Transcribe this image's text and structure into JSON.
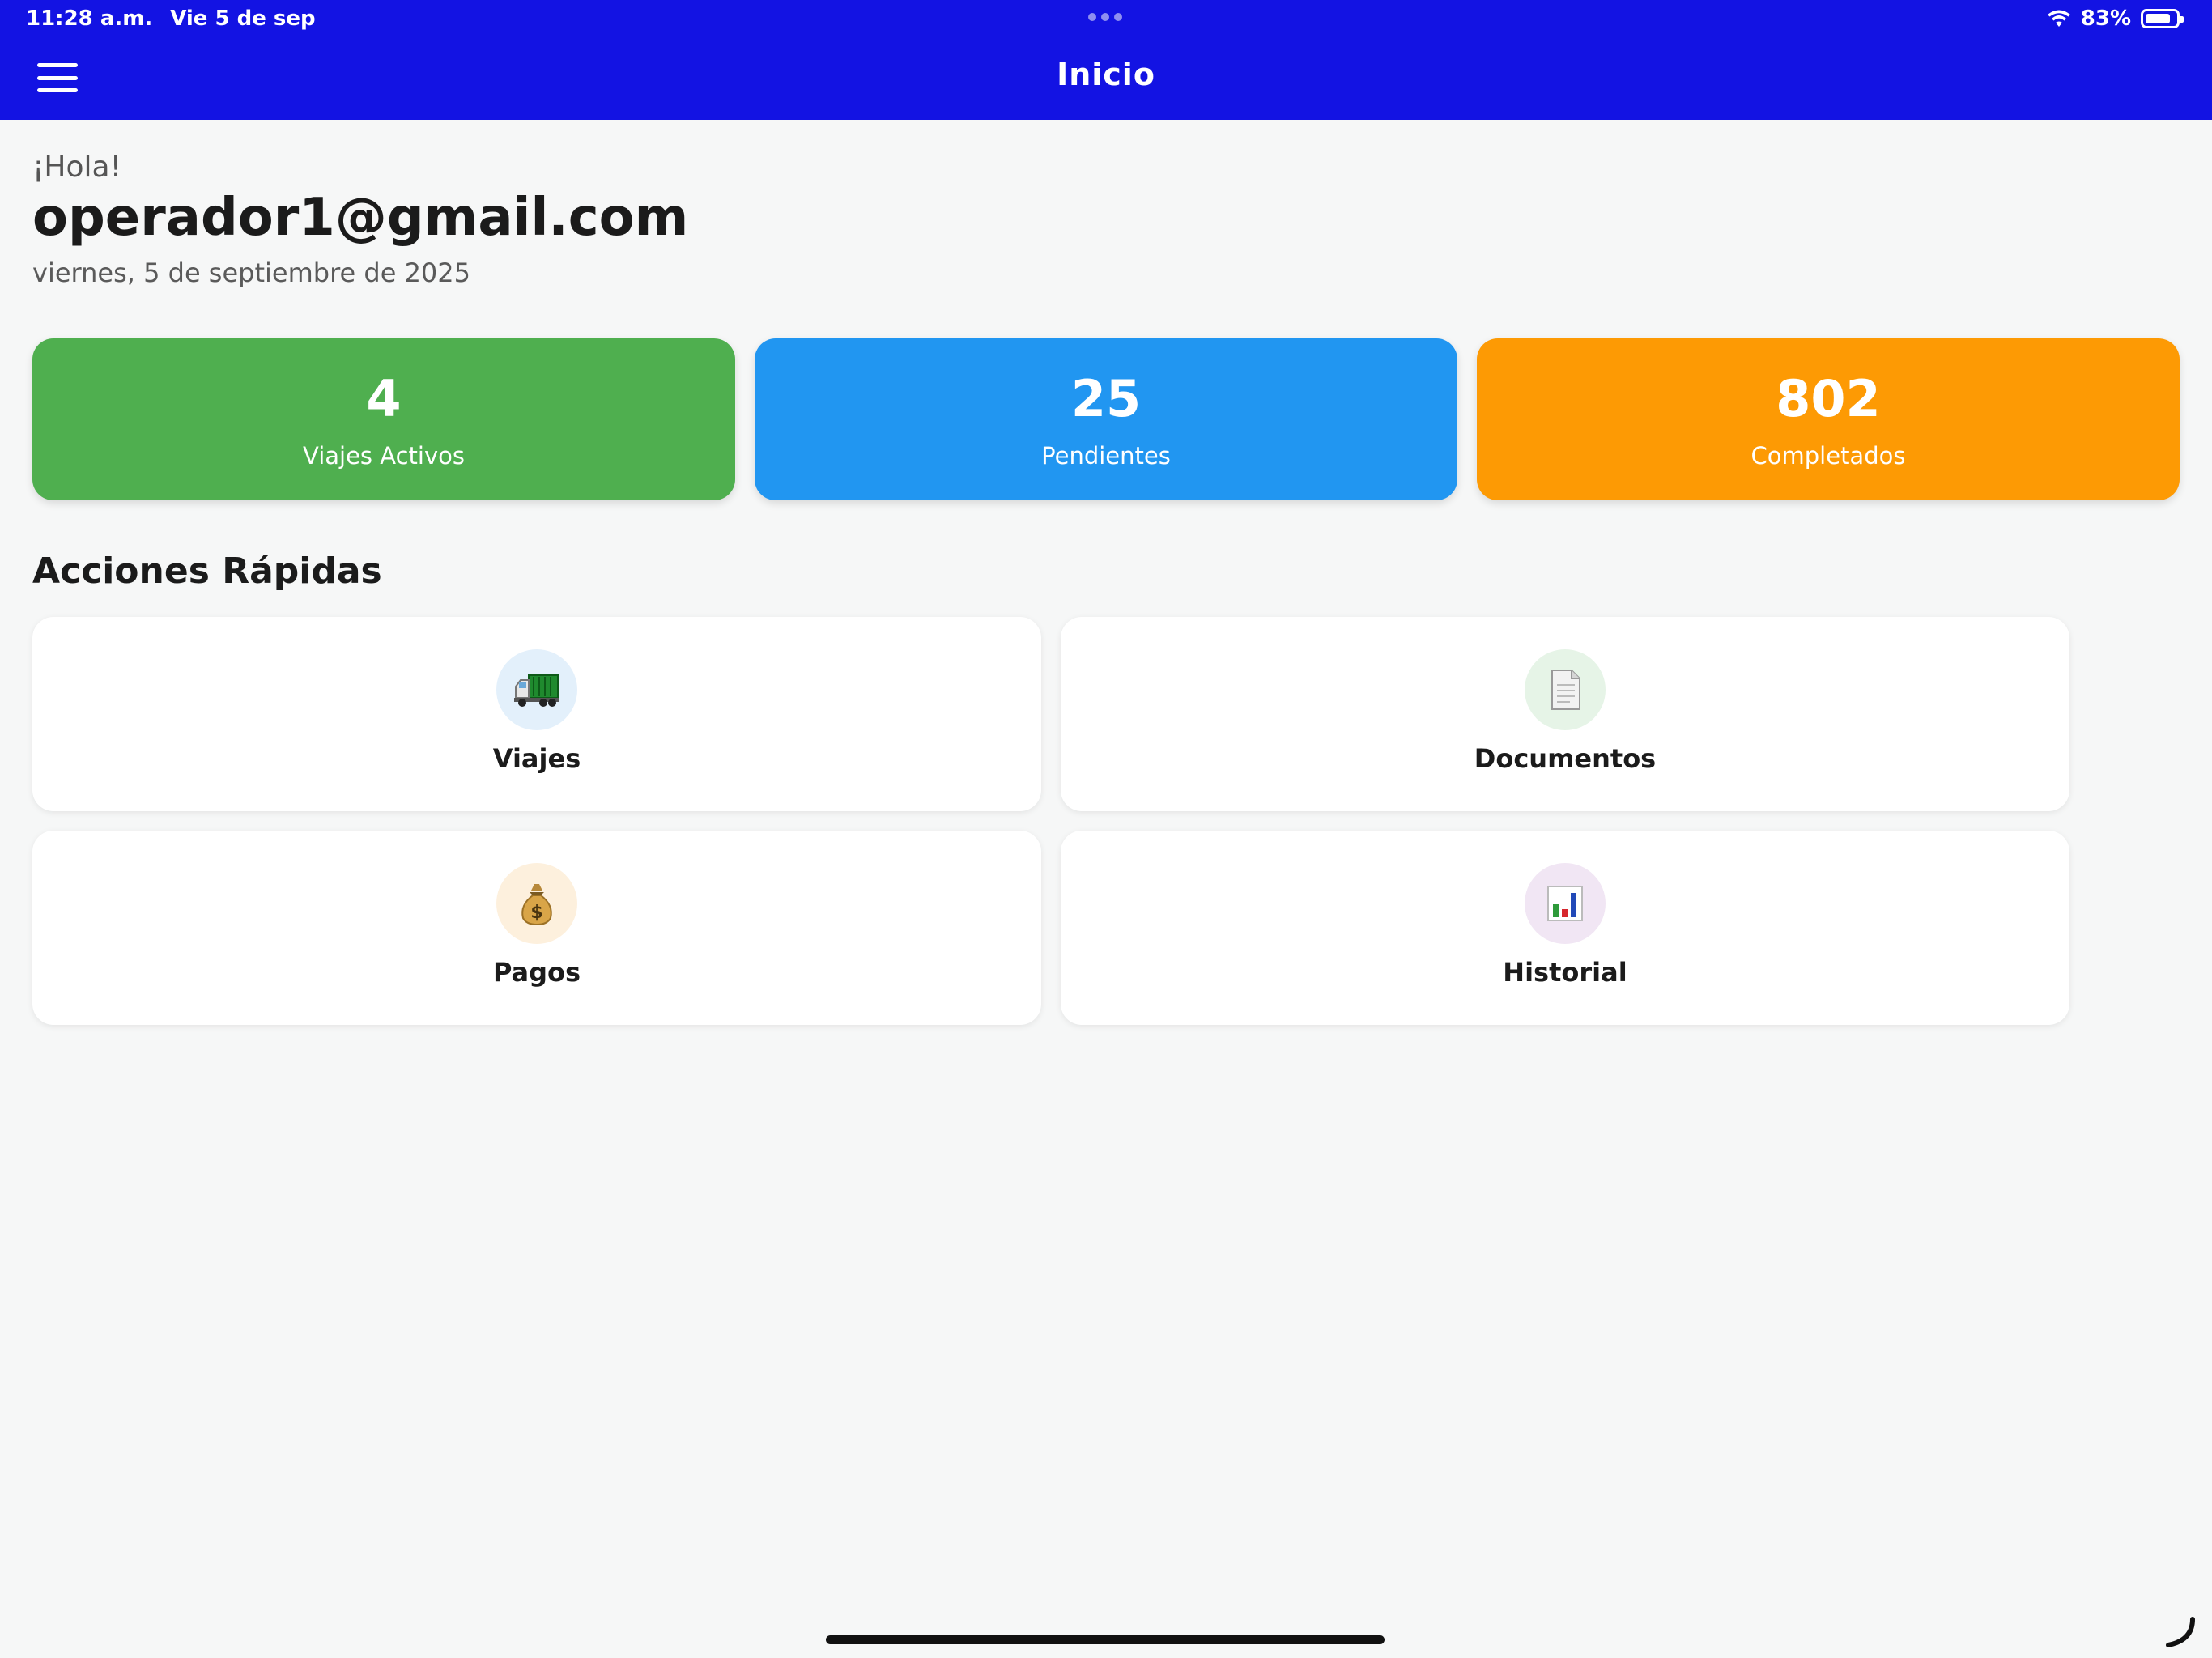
{
  "status_bar": {
    "time": "11:28 a.m.",
    "date": "Vie 5 de sep",
    "battery": "83%",
    "battery_level": 0.83
  },
  "header": {
    "title": "Inicio",
    "menu_icon": "hamburger-menu-icon"
  },
  "greeting": {
    "hello": "¡Hola!",
    "email": "operador1@gmail.com",
    "date": "viernes, 5 de septiembre de 2025"
  },
  "stats": [
    {
      "value": "4",
      "label": "Viajes Activos",
      "color": "#4faf4f"
    },
    {
      "value": "25",
      "label": "Pendientes",
      "color": "#2196f1"
    },
    {
      "value": "802",
      "label": "Completados",
      "color": "#fd9a04"
    }
  ],
  "quick_actions": {
    "title": "Acciones Rápidas",
    "items": [
      {
        "label": "Viajes",
        "icon": "truck-icon",
        "icon_bg": "#e3f0fb"
      },
      {
        "label": "Documentos",
        "icon": "document-icon",
        "icon_bg": "#e6f4e7"
      },
      {
        "label": "Pagos",
        "icon": "money-bag-icon",
        "icon_bg": "#fdf0dd"
      },
      {
        "label": "Historial",
        "icon": "bar-chart-icon",
        "icon_bg": "#f1e6f4"
      }
    ]
  },
  "colors": {
    "header": "#1313e3",
    "background": "#f6f7f7"
  }
}
